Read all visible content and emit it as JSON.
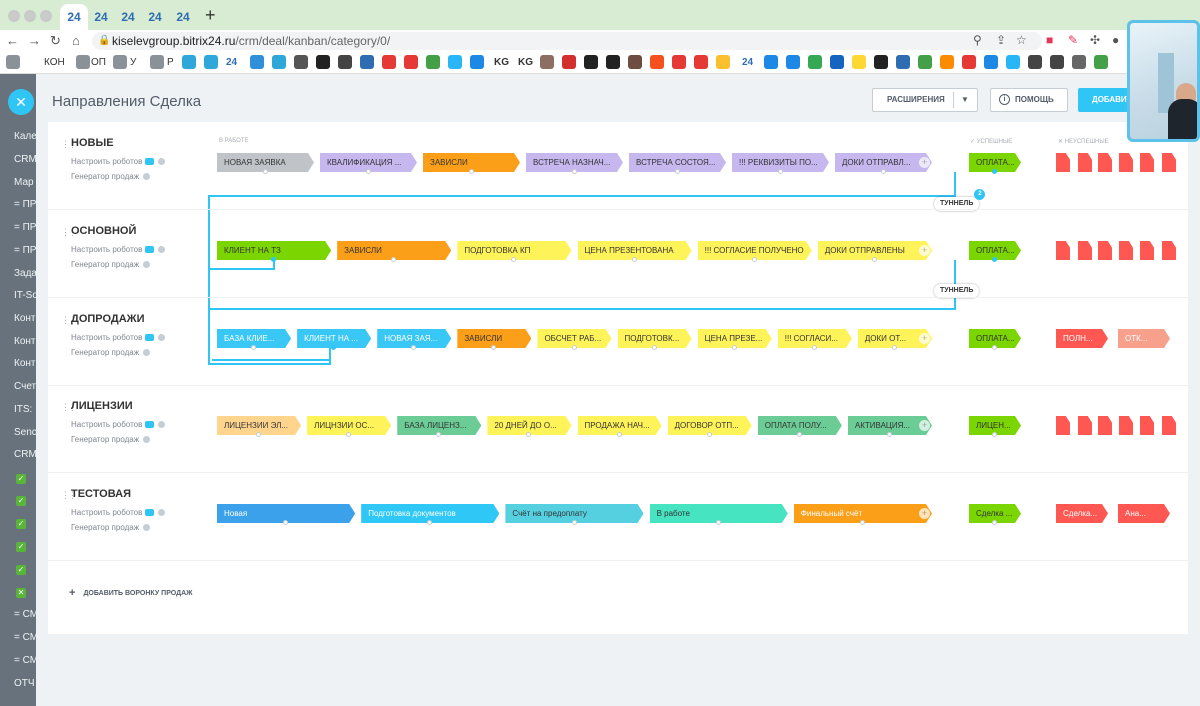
{
  "browser": {
    "tabs": [
      "24",
      "24",
      "24",
      "24",
      "24"
    ],
    "url_host": "kiselevgroup.bitrix24.ru",
    "url_path": "/crm/deal/kanban/category/0/",
    "bookmarks": [
      "КОН",
      "ОП",
      "У",
      "Р",
      "24",
      "KG",
      "KG",
      "24"
    ]
  },
  "leftnav": {
    "items": [
      "Кале",
      "CRM",
      "Мар",
      "= ПР",
      "= ПР",
      "= ПР",
      "Зада",
      "IT-Sc",
      "Конт",
      "Конт",
      "Конт",
      "Счет",
      "ITS:",
      "Senc",
      "CRM",
      "= СМ",
      "= СМ",
      "= СМ",
      "ОТЧ"
    ],
    "checks": [
      "CI",
      "CI",
      "CI",
      "CI",
      "CI",
      "CI"
    ]
  },
  "header": {
    "title": "Направления Сделка",
    "extensions_label": "РАСШИРЕНИЯ",
    "help_label": "ПОМОЩЬ",
    "add_label": "ДОБАВИТЬ"
  },
  "columns": {
    "in_work": "В РАБОТЕ",
    "success": "✓ УСПЕШНЫЕ",
    "fail": "✕ НЕУСПЕШНЫЕ"
  },
  "common": {
    "robots_link": "Настроить роботов",
    "generator_link": "Генератор продаж"
  },
  "funnels": [
    {
      "name": "НОВЫЕ",
      "stages": [
        {
          "label": "НОВАЯ ЗАЯВКА",
          "color": "#c0c4c9"
        },
        {
          "label": "КВАЛИФИКАЦИЯ ...",
          "color": "#c6b7ee"
        },
        {
          "label": "ЗАВИСЛИ",
          "color": "#fb9f19"
        },
        {
          "label": "ВСТРЕЧА НАЗНАЧ...",
          "color": "#c6b7ee"
        },
        {
          "label": "ВСТРЕЧА СОСТОЯ...",
          "color": "#c6b7ee"
        },
        {
          "label": "!!! РЕКВИЗИТЫ ПО...",
          "color": "#c6b7ee"
        },
        {
          "label": "ДОКИ ОТПРАВЛ...",
          "color": "#c6b7ee"
        }
      ],
      "success": {
        "label": "ОПЛАТА...",
        "color": "#7bd500"
      },
      "fail_color": "#ff5752"
    },
    {
      "name": "ОСНОВНОЙ",
      "stages": [
        {
          "label": "КЛИЕНТ НА ТЗ",
          "color": "#7bd500"
        },
        {
          "label": "ЗАВИСЛИ",
          "color": "#fb9f19"
        },
        {
          "label": "ПОДГОТОВКА КП",
          "color": "#fff35a"
        },
        {
          "label": "ЦЕНА ПРЕЗЕНТОВАНА",
          "color": "#fff35a"
        },
        {
          "label": "!!! СОГЛАСИЕ ПОЛУЧЕНО",
          "color": "#fff35a"
        },
        {
          "label": "ДОКИ ОТПРАВЛЕНЫ",
          "color": "#fff35a"
        }
      ],
      "success": {
        "label": "ОПЛАТА...",
        "color": "#7bd500"
      },
      "fail_color": "#ff5752"
    },
    {
      "name": "ДОПРОДАЖИ",
      "stages": [
        {
          "label": "БАЗА КЛИЕ...",
          "color": "#39c7f5"
        },
        {
          "label": "КЛИЕНТ НА ...",
          "color": "#39c7f5"
        },
        {
          "label": "НОВАЯ ЗАЯ...",
          "color": "#39c7f5"
        },
        {
          "label": "ЗАВИСЛИ",
          "color": "#fb9f19"
        },
        {
          "label": "ОБСЧЕТ РАБ...",
          "color": "#fff35a"
        },
        {
          "label": "ПОДГОТОВК...",
          "color": "#fff35a"
        },
        {
          "label": "ЦЕНА ПРЕЗЕ...",
          "color": "#fff35a"
        },
        {
          "label": "!!! СОГЛАСИ...",
          "color": "#fff35a"
        },
        {
          "label": "ДОКИ ОТ...",
          "color": "#fff35a"
        }
      ],
      "success": {
        "label": "ОПЛАТА...",
        "color": "#7bd500"
      },
      "fail_stages": [
        {
          "label": "ПОЛН...",
          "color": "#ff5752"
        },
        {
          "label": "ОТК...",
          "color": "#f7a08c"
        }
      ]
    },
    {
      "name": "ЛИЦЕНЗИИ",
      "stages": [
        {
          "label": "ЛИЦЕНЗИИ ЭЛ...",
          "color": "#ffd58e"
        },
        {
          "label": "ЛИЦНЗИИ ОС...",
          "color": "#fff35a"
        },
        {
          "label": "БАЗА ЛИЦЕНЗ...",
          "color": "#6bcc96"
        },
        {
          "label": "20 ДНЕЙ ДО О...",
          "color": "#fff35a"
        },
        {
          "label": "ПРОДАЖА НАЧ...",
          "color": "#fff35a"
        },
        {
          "label": "ДОГОВОР ОТП...",
          "color": "#fff35a"
        },
        {
          "label": "ОПЛАТА ПОЛУ...",
          "color": "#6bcc96"
        },
        {
          "label": "АКТИВАЦИЯ...",
          "color": "#6bcc96"
        }
      ],
      "success": {
        "label": "ЛИЦЕН...",
        "color": "#7bd500"
      },
      "fail_color": "#ff5752"
    },
    {
      "name": "ТЕСТОВАЯ",
      "stages": [
        {
          "label": "Новая",
          "color": "#3aa1ea"
        },
        {
          "label": "Подготовка документов",
          "color": "#2ec7f6"
        },
        {
          "label": "Счёт на предоплату",
          "color": "#55d0e0"
        },
        {
          "label": "В работе",
          "color": "#47e4c2"
        },
        {
          "label": "Финальный счёт",
          "color": "#fb9f19"
        }
      ],
      "success": {
        "label": "Сделка ...",
        "color": "#7bd500"
      },
      "fail_stages": [
        {
          "label": "Сделка...",
          "color": "#ff5752"
        },
        {
          "label": "Ана...",
          "color": "#ff5752"
        }
      ]
    }
  ],
  "tunnels": [
    "ТУННЕЛЬ",
    "ТУННЕЛЬ"
  ],
  "tunnel_badge": "2",
  "add_funnel_label": "ДОБАВИТЬ ВОРОНКУ ПРОДАЖ"
}
